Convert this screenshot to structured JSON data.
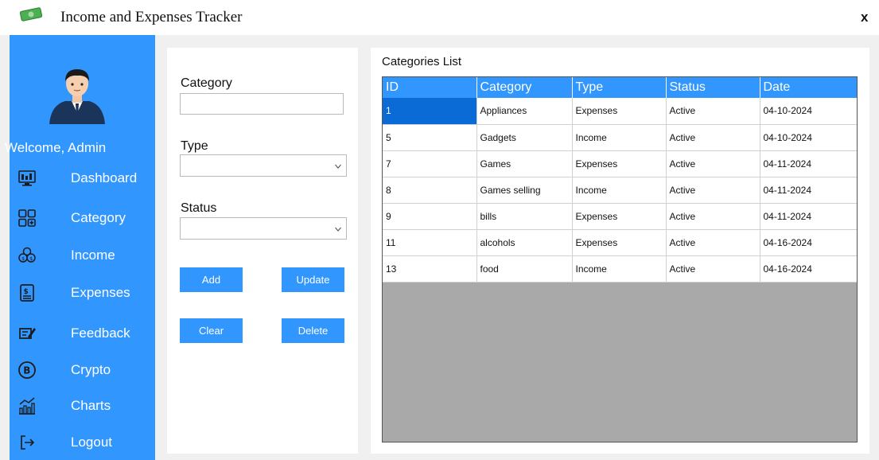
{
  "window": {
    "title": "Income and Expenses Tracker",
    "close_label": "x"
  },
  "sidebar": {
    "welcome": "Welcome, Admin",
    "items": [
      {
        "label": "Dashboard",
        "icon": "dashboard-icon"
      },
      {
        "label": "Category",
        "icon": "category-grid-icon"
      },
      {
        "label": "Income",
        "icon": "coins-icon"
      },
      {
        "label": "Expenses",
        "icon": "bill-icon"
      },
      {
        "label": "Feedback",
        "icon": "feedback-icon"
      },
      {
        "label": "Crypto",
        "icon": "bitcoin-icon"
      },
      {
        "label": "Charts",
        "icon": "chart-icon"
      },
      {
        "label": "Logout",
        "icon": "logout-icon"
      }
    ]
  },
  "form": {
    "category_label": "Category",
    "category_value": "",
    "type_label": "Type",
    "type_value": "",
    "status_label": "Status",
    "status_value": "",
    "add_label": "Add",
    "update_label": "Update",
    "clear_label": "Clear",
    "delete_label": "Delete"
  },
  "grid": {
    "title": "Categories List",
    "columns": [
      "ID",
      "Category",
      "Type",
      "Status",
      "Date"
    ],
    "rows": [
      [
        "1",
        "Appliances",
        "Expenses",
        "Active",
        "04-10-2024"
      ],
      [
        "5",
        "Gadgets",
        "Income",
        "Active",
        "04-10-2024"
      ],
      [
        "7",
        "Games",
        "Expenses",
        "Active",
        "04-11-2024"
      ],
      [
        "8",
        "Games selling",
        "Income",
        "Active",
        "04-11-2024"
      ],
      [
        "9",
        "bills",
        "Expenses",
        "Active",
        "04-11-2024"
      ],
      [
        "11",
        "alcohols",
        "Expenses",
        "Active",
        "04-16-2024"
      ],
      [
        "13",
        "food",
        "Income",
        "Active",
        "04-16-2024"
      ]
    ]
  },
  "colors": {
    "accent": "#3296ff",
    "selected_cell": "#0a6ad6",
    "grid_empty": "#a9a9a9"
  }
}
